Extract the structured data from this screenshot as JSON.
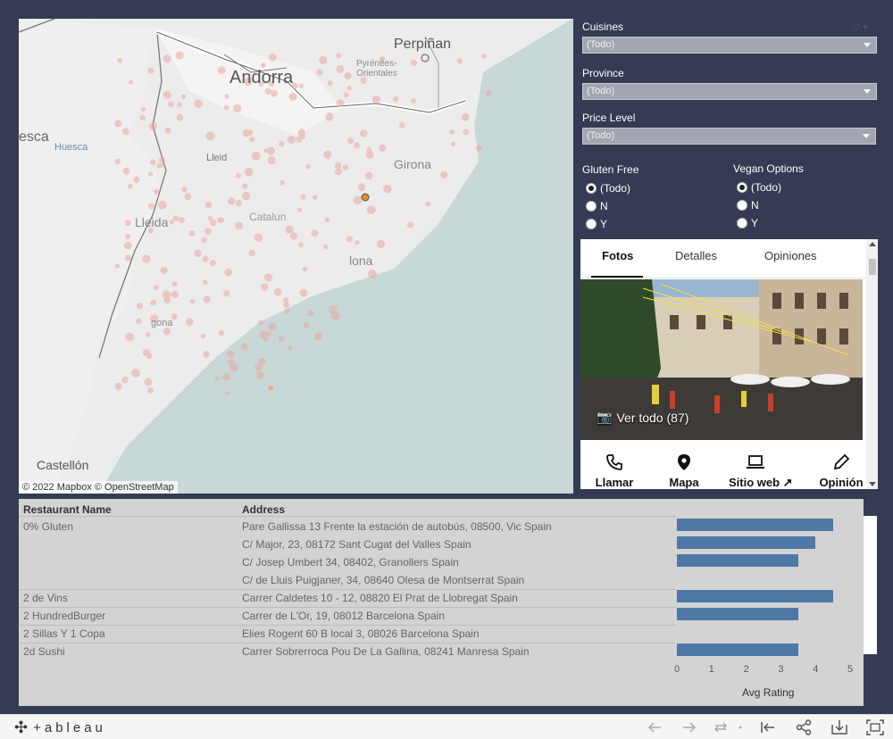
{
  "map": {
    "labels": {
      "perpinan": "Perpiñan",
      "andorra": "Andorra",
      "pyrenees": "Pyrénées-\nOrientales",
      "huesca_city": "esca",
      "huesca_prov": "Huesca",
      "lleida_prov": "Lleid",
      "girona": "Girona",
      "lleida": "Lleida",
      "catalunya": "Catalun",
      "barcelona": "lona",
      "tarragona": "gona",
      "castellon": "Castellón"
    },
    "attribution": "© 2022 Mapbox  © OpenStreetMap"
  },
  "filters": {
    "cuisines": {
      "title": "Cuisines",
      "value": "(Todo)"
    },
    "province": {
      "title": "Province",
      "value": "(Todo)"
    },
    "price_level": {
      "title": "Price Level",
      "value": "(Todo)"
    },
    "gluten_free": {
      "title": "Gluten Free",
      "options": [
        "(Todo)",
        "N",
        "Y"
      ],
      "selected": "(Todo)"
    },
    "vegan_options": {
      "title": "Vegan Options",
      "options": [
        "(Todo)",
        "N",
        "Y"
      ],
      "selected": "(Todo)"
    }
  },
  "panel": {
    "tabs": [
      "Fotos",
      "Detalles",
      "Opiniones"
    ],
    "active_tab": "Fotos",
    "photo_overlay": "Ver todo (87)",
    "actions": [
      {
        "label": "Llamar",
        "icon": "phone-icon"
      },
      {
        "label": "Mapa",
        "icon": "map-pin-icon"
      },
      {
        "label": "Sitio web ↗",
        "icon": "laptop-icon"
      },
      {
        "label": "Opinión",
        "icon": "pencil-icon"
      }
    ]
  },
  "table": {
    "headers": {
      "name": "Restaurant Name",
      "address": "Address"
    },
    "rows": [
      {
        "name": "0% Gluten",
        "address": "Pare Gallissa 13 Frente la estación de autobús, 08500, Vic Spain",
        "rating": 4.5
      },
      {
        "name": "",
        "address": "C/ Major, 23, 08172 Sant Cugat del Valles Spain",
        "rating": 4.0
      },
      {
        "name": "",
        "address": "C/ Josep Umbert 34, 08402, Granollers Spain",
        "rating": 3.5
      },
      {
        "name": "",
        "address": "C/ de Lluis Puigjaner, 34, 08640 Olesa de Montserrat Spain",
        "rating": null
      },
      {
        "name": "2 de Vins",
        "address": "Carrer Caldetes 10 - 12, 08820 El Prat de Llobregat Spain",
        "rating": 4.5
      },
      {
        "name": "2 HundredBurger",
        "address": "Carrer de L'Or, 19, 08012 Barcelona Spain",
        "rating": 3.5
      },
      {
        "name": "2 Sillas Y 1 Copa",
        "address": "Elies Rogent 60 B local 3, 08026 Barcelona Spain",
        "rating": null
      },
      {
        "name": "2d Sushi",
        "address": "Carrer Sobrerroca Pou De La Gallina, 08241 Manresa Spain",
        "rating": 3.5
      }
    ]
  },
  "chart_data": {
    "type": "bar",
    "orientation": "horizontal",
    "xlabel": "Avg Rating",
    "xlim": [
      0,
      5
    ],
    "ticks": [
      "0",
      "1",
      "2",
      "3",
      "4",
      "5"
    ],
    "values": [
      4.5,
      4.0,
      3.5,
      null,
      4.5,
      3.5,
      null,
      3.5
    ],
    "color": "#4e79a7"
  },
  "footer": {
    "logo": "+ableau"
  }
}
